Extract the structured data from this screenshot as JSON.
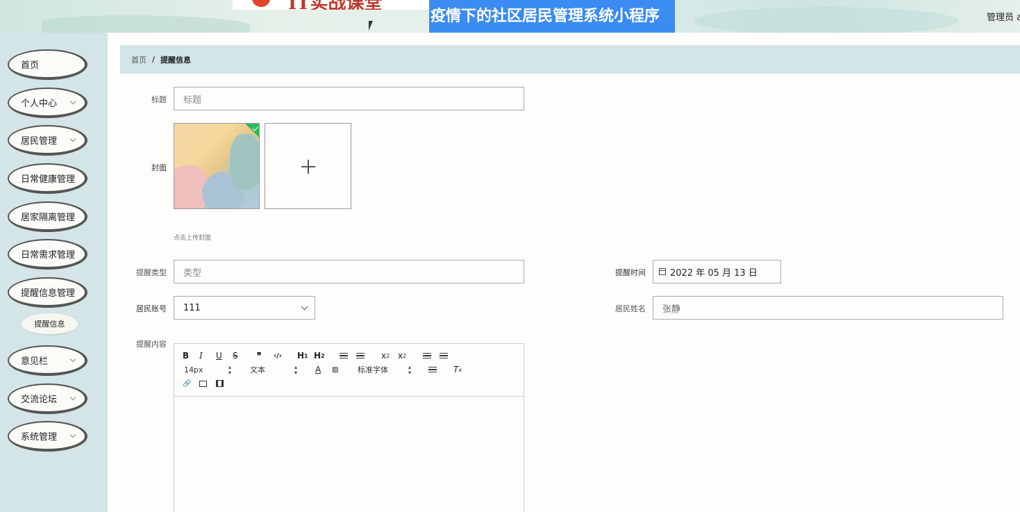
{
  "header": {
    "logo_text": "IT实战课堂",
    "system_title": "疫情下的社区居民管理系统小程序",
    "admin_label": "管理员 a"
  },
  "sidebar": {
    "items": [
      {
        "label": "首页",
        "has_arrow": false
      },
      {
        "label": "个人中心",
        "has_arrow": true
      },
      {
        "label": "居民管理",
        "has_arrow": true
      },
      {
        "label": "日常健康管理",
        "has_arrow": false
      },
      {
        "label": "居家隔离管理",
        "has_arrow": false
      },
      {
        "label": "日常需求管理",
        "has_arrow": false
      },
      {
        "label": "提醒信息管理",
        "has_arrow": false
      },
      {
        "label": "意见栏",
        "has_arrow": true
      },
      {
        "label": "交流论坛",
        "has_arrow": true
      },
      {
        "label": "系统管理",
        "has_arrow": true
      }
    ],
    "sub_item": "提醒信息"
  },
  "breadcrumb": {
    "home": "首页",
    "separator": "/",
    "current": "提醒信息"
  },
  "form": {
    "title_label": "标题",
    "title_placeholder": "标题",
    "cover_label": "封面",
    "cover_hint": "点击上传封面",
    "type_label": "提醒类型",
    "type_placeholder": "类型",
    "time_label": "提醒时间",
    "time_value": "2022 年 05 月 13 日",
    "account_label": "居民账号",
    "account_value": "111",
    "name_label": "居民姓名",
    "name_value": "张静",
    "content_label": "提醒内容"
  },
  "editor": {
    "font_size": "14px",
    "text_style": "文本",
    "font_family": "标准字体"
  }
}
